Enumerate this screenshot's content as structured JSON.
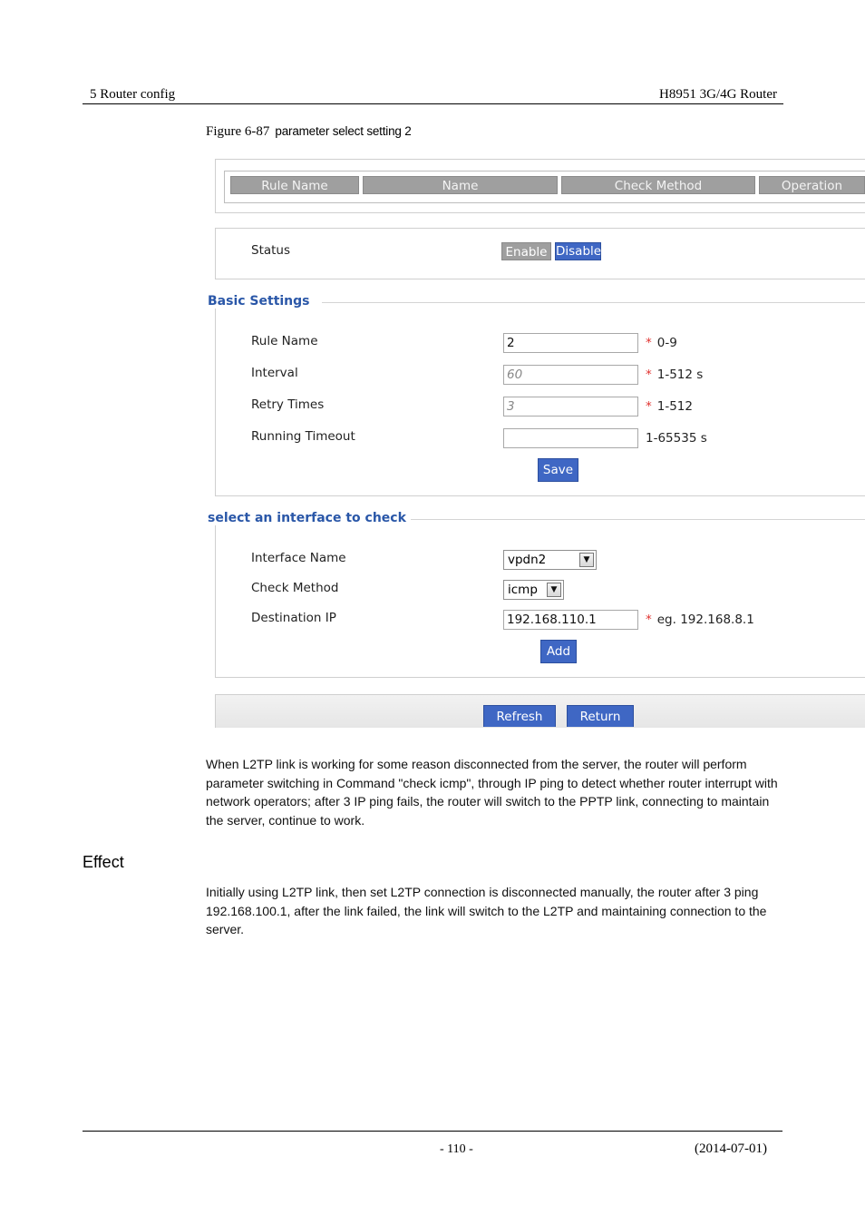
{
  "header": {
    "left": "5 Router config",
    "right": "H8951 3G/4G Router"
  },
  "figure": {
    "label": "Figure 6-87",
    "caption": "parameter select setting 2"
  },
  "table": {
    "columns": [
      "Rule Name",
      "Name",
      "Check Method",
      "Operation"
    ]
  },
  "status": {
    "label": "Status",
    "enable": "Enable",
    "disable": "Disable"
  },
  "basic": {
    "title": "Basic Settings",
    "fields": [
      {
        "label": "Rule Name",
        "value": "2",
        "placeholder": "",
        "required": "*",
        "hint": "0-9"
      },
      {
        "label": "Interval",
        "value": "",
        "placeholder": "60",
        "required": "*",
        "hint": "1-512 s"
      },
      {
        "label": "Retry Times",
        "value": "",
        "placeholder": "3",
        "required": "*",
        "hint": "1-512"
      },
      {
        "label": "Running Timeout",
        "value": "",
        "placeholder": "",
        "required": "",
        "hint": "1-65535 s"
      }
    ],
    "save": "Save"
  },
  "iface": {
    "title": "select an interface to check",
    "interface_label": "Interface Name",
    "interface_value": "vpdn2",
    "method_label": "Check Method",
    "method_value": "icmp",
    "dest_label": "Destination IP",
    "dest_value": "192.168.110.1",
    "dest_required": "*",
    "dest_hint": "eg. 192.168.8.1",
    "add": "Add"
  },
  "footer_buttons": {
    "refresh": "Refresh",
    "return": "Return"
  },
  "body": {
    "para1": "When L2TP link is working for some reason disconnected from the server, the router will perform parameter switching in Command \"check icmp\", through IP ping to detect whether router interrupt with network operators; after 3 IP ping fails, the router will switch to the PPTP link, connecting to maintain the server, continue to work.",
    "effect_heading": "Effect",
    "para2": "Initially using L2TP link, then set L2TP connection is disconnected manually, the router after 3 ping 192.168.100.1, after the link failed, the link will switch to the L2TP and maintaining connection to the server."
  },
  "page_footer": {
    "page": "- 110 -",
    "date": "(2014-07-01)"
  }
}
